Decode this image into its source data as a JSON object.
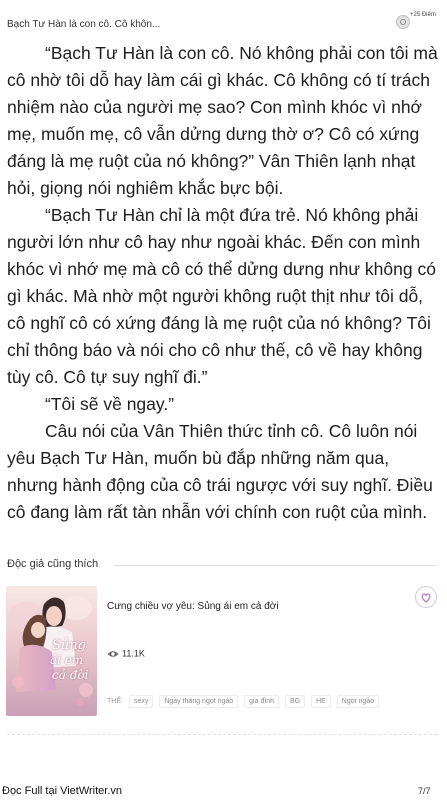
{
  "header": {
    "chapter_title": "Bạch Tư Hàn là con cô. Cô khôn...",
    "points": "+25 Điểm",
    "coin_icon": "coin-icon"
  },
  "content": {
    "paragraphs": [
      "“Bạch Tư Hàn là con cô. Nó không phải con tôi mà cô nhờ tôi dỗ hay làm cái gì khác. Cô không có tí trách nhiệm nào của người mẹ sao? Con mình khóc vì nhớ mẹ, muốn mẹ, cô vẫn dửng dưng thờ ơ? Cô có xứng đáng là mẹ ruột của nó không?” Vân Thiên lạnh nhạt hỏi, giọng nói nghiêm khắc bực bội.",
      "“Bạch Tư Hàn chỉ là một đứa trẻ. Nó không phải người lớn như cô hay như ngoài khác. Đến con mình khóc vì nhớ mẹ mà cô có thể dửng dưng như không có gì khác. Mà nhờ một người không ruột thịt như tôi dỗ, cô nghĩ cô có xứng đáng là mẹ ruột của nó không? Tôi chỉ thông báo và nói cho cô như thế, cô về hay không tùy cô. Cô tự suy nghĩ đi.”",
      "“Tôi sẽ về ngay.”",
      "Câu nói của Vân Thiên thức tỉnh cô. Cô luôn nói yêu  Bạch Tư Hàn, muốn bù đắp những năm qua, nhưng hành động của cô trái ngược với suy nghĩ. Điều cô đang làm rất tàn nhẫn với chính con ruột của mình."
    ]
  },
  "recommend": {
    "section_title": "Độc giả cũng thích",
    "book": {
      "title": "Cưng chiều vợ yêu: Sủng ái em cả đời",
      "views": "11.1K",
      "cover_text": [
        "Sủng",
        "ái em",
        "cả đời"
      ],
      "tag_label": "THỂ",
      "tags": [
        "sexy",
        "Ngày tháng ngọt ngào",
        "gia đình",
        "BG",
        "HE",
        "Ngọt ngào"
      ],
      "heart_icon": "heart-icon",
      "eye_icon": "eye-icon"
    }
  },
  "footer": {
    "site_text": "Đọc Full tại VietWriter.vn",
    "page_indicator": "7/7"
  },
  "colors": {
    "text": "#1f1f1f",
    "heart": "#b07cc6",
    "muted": "#888888"
  }
}
